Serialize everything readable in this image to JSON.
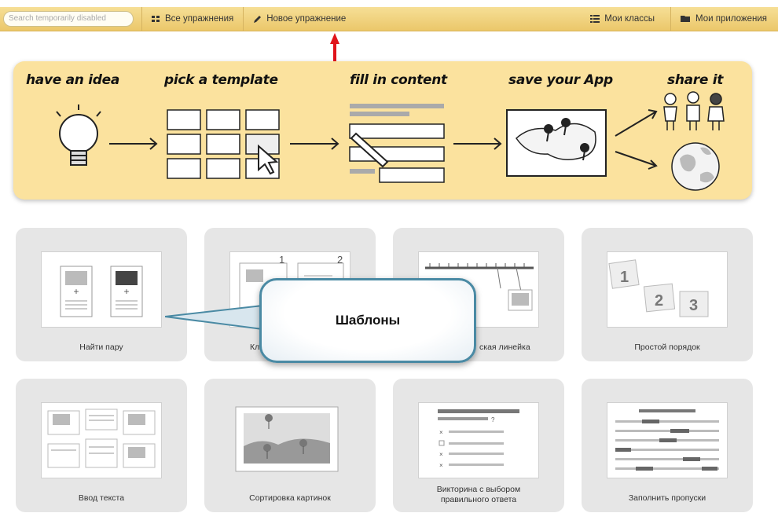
{
  "nav": {
    "search_placeholder": "Search temporarily disabled",
    "all_exercises": "Все упражнения",
    "new_exercise": "Новое упражнение",
    "my_classes": "Мои классы",
    "my_apps": "Мои приложения"
  },
  "banner": {
    "steps": [
      "have an idea",
      "pick a template",
      "fill in content",
      "save your App",
      "share it"
    ]
  },
  "callout": {
    "text": "Шаблоны"
  },
  "templates": [
    {
      "label": "Найти пару"
    },
    {
      "label": "Кл"
    },
    {
      "label": "ская линейка"
    },
    {
      "label": "Простой порядок"
    },
    {
      "label": "Ввод текста"
    },
    {
      "label": "Сортировка картинок"
    },
    {
      "label_line1": "Викторина с выбором",
      "label_line2": "правильного ответа"
    },
    {
      "label": "Заполнить пропуски"
    }
  ],
  "colors": {
    "bar": "#ebc76a",
    "banner": "#fbe29e",
    "card": "#e6e6e6",
    "arrow": "#e0141b",
    "callout_border": "#4a8aa4"
  }
}
